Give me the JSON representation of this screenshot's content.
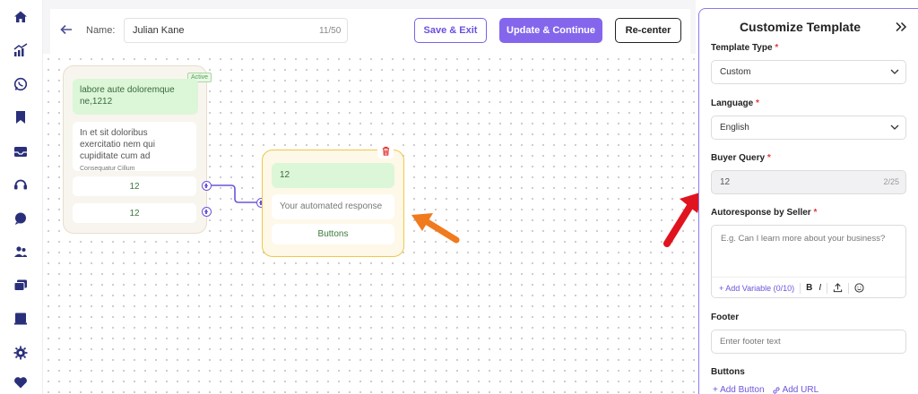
{
  "colors": {
    "accent": "#8466ec",
    "annotation_arrow_orange": "#f07a1e",
    "annotation_arrow_red": "#e0141e",
    "node_message_bg": "#dcf6d8",
    "node2_border": "#f0c64a"
  },
  "sidebar": {
    "icons": [
      "home-icon",
      "analytics-icon",
      "whatsapp-icon",
      "bookmark-icon",
      "inbox-icon",
      "support-icon",
      "chat-icon",
      "users-icon",
      "messages-icon",
      "book-icon",
      "settings-icon",
      "heart-icon"
    ]
  },
  "topbar": {
    "name_label": "Name:",
    "name_value": "Julian Kane",
    "name_count": "11/50",
    "save_exit_label": "Save & Exit",
    "update_continue_label": "Update & Continue",
    "recenter_label": "Re-center"
  },
  "canvas": {
    "node1": {
      "badge": "Active",
      "message": "labore aute doloremque ne,1212",
      "body": "In et sit doloribus exercitatio nem qui cupiditate cum ad",
      "body_sub": "Consequatur Cillum",
      "options": [
        "12",
        "12"
      ]
    },
    "node2": {
      "message": "12",
      "autoresponse": "Your automated response",
      "buttons_label": "Buttons"
    }
  },
  "panel": {
    "title": "Customize Template",
    "template_type": {
      "label": "Template Type",
      "value": "Custom"
    },
    "language": {
      "label": "Language",
      "value": "English"
    },
    "buyer_query": {
      "label": "Buyer Query",
      "value": "12",
      "count": "2/25"
    },
    "autoresponse": {
      "label": "Autoresponse by Seller",
      "placeholder": "E.g. Can I learn more about your business?",
      "add_variable": "+ Add Variable (0/10)",
      "bold": "B",
      "italic": "I"
    },
    "footer": {
      "label": "Footer",
      "placeholder": "Enter footer text"
    },
    "buttons": {
      "label": "Buttons",
      "add_button": "+ Add Button",
      "add_url": "Add URL"
    }
  }
}
